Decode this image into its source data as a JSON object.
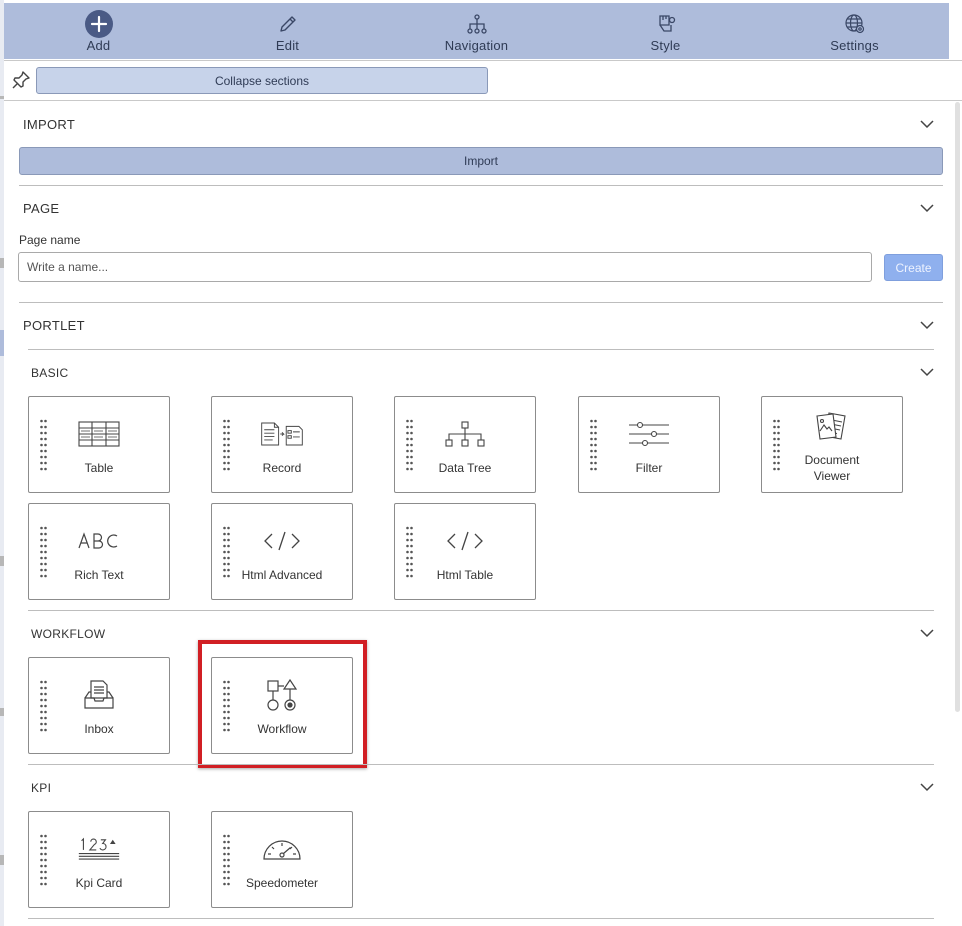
{
  "toolbar": {
    "items": [
      {
        "label": "Add",
        "icon": "plus-circle-icon"
      },
      {
        "label": "Edit",
        "icon": "pencil-icon"
      },
      {
        "label": "Navigation",
        "icon": "sitemap-icon"
      },
      {
        "label": "Style",
        "icon": "paint-bucket-icon"
      },
      {
        "label": "Settings",
        "icon": "globe-gear-icon"
      }
    ]
  },
  "pin_row": {
    "collapse_label": "Collapse sections",
    "pin_icon": "pin-icon"
  },
  "import_section": {
    "title": "IMPORT",
    "button_label": "Import"
  },
  "page_section": {
    "title": "PAGE",
    "field_label": "Page name",
    "input_value": "",
    "input_placeholder": "Write a name...",
    "create_label": "Create"
  },
  "portlet_section": {
    "title": "PORTLET",
    "groups": {
      "basic": {
        "title": "BASIC",
        "cards": [
          {
            "label": "Table",
            "icon": "table-icon"
          },
          {
            "label": "Record",
            "icon": "record-icon"
          },
          {
            "label": "Data Tree",
            "icon": "data-tree-icon"
          },
          {
            "label": "Filter",
            "icon": "filter-sliders-icon"
          },
          {
            "label": "Document Viewer",
            "icon": "document-viewer-icon"
          },
          {
            "label": "Rich Text",
            "icon": "rich-text-abc-icon"
          },
          {
            "label": "Html Advanced",
            "icon": "code-icon"
          },
          {
            "label": "Html Table",
            "icon": "code-icon"
          }
        ]
      },
      "workflow": {
        "title": "WORKFLOW",
        "cards": [
          {
            "label": "Inbox",
            "icon": "inbox-icon"
          },
          {
            "label": "Workflow",
            "icon": "workflow-icon"
          }
        ]
      },
      "kpi": {
        "title": "KPI",
        "cards": [
          {
            "label": "Kpi Card",
            "icon": "kpi-card-icon"
          },
          {
            "label": "Speedometer",
            "icon": "speedometer-icon"
          }
        ]
      }
    }
  },
  "colors": {
    "toolbar_bg": "#aebcdb",
    "button_bg": "#c7d3ea",
    "create_bg": "#8fb0ee",
    "highlight": "#d11f24"
  }
}
